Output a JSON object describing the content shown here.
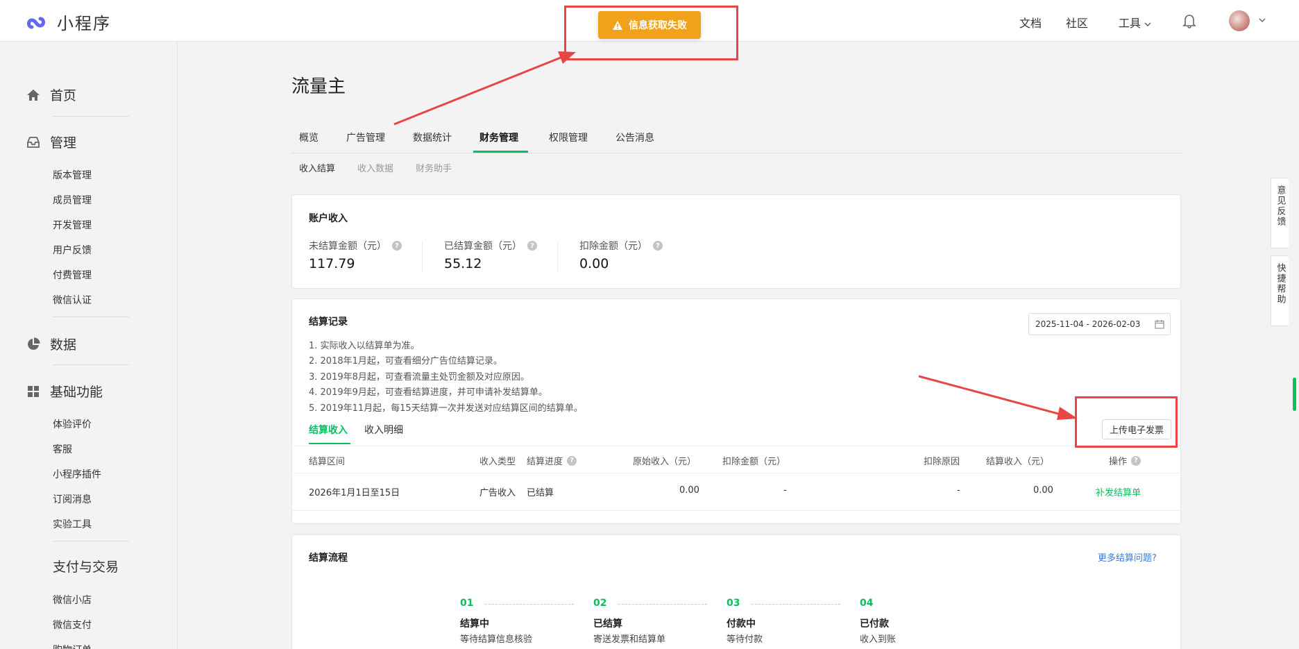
{
  "app": {
    "name": "小程序"
  },
  "topbar": {
    "nav": [
      "文档",
      "社区",
      "工具"
    ],
    "toast": "信息获取失败"
  },
  "sidebar": {
    "groups": [
      {
        "label": "首页",
        "icon": "home-icon"
      },
      {
        "label": "管理",
        "icon": "inbox-icon",
        "items": [
          "版本管理",
          "成员管理",
          "开发管理",
          "用户反馈",
          "付费管理",
          "微信认证"
        ]
      },
      {
        "label": "数据",
        "icon": "pie-chart-icon"
      },
      {
        "label": "基础功能",
        "icon": "grid-icon",
        "items": [
          "体验评价",
          "客服",
          "小程序插件",
          "订阅消息",
          "实验工具"
        ]
      },
      {
        "label": "支付与交易",
        "items": [
          "微信小店",
          "微信支付",
          "购物订单"
        ]
      }
    ]
  },
  "page": {
    "title": "流量主",
    "tabs": [
      "概览",
      "广告管理",
      "数据统计",
      "财务管理",
      "权限管理",
      "公告消息"
    ],
    "active_tab": "财务管理",
    "subtabs": [
      "收入结算",
      "收入数据",
      "财务助手"
    ]
  },
  "account": {
    "title": "账户收入",
    "metrics": [
      {
        "label": "未结算金额（元）",
        "value": "117.79"
      },
      {
        "label": "已结算金额（元）",
        "value": "55.12"
      },
      {
        "label": "扣除金额（元）",
        "value": "0.00"
      }
    ]
  },
  "records": {
    "title": "结算记录",
    "date_range": "2025-11-04 - 2026-02-03",
    "notes": [
      "1. 实际收入以结算单为准。",
      "2. 2018年1月起，可查看细分广告位结算记录。",
      "3. 2019年8月起，可查看流量主处罚金额及对应原因。",
      "4. 2019年9月起，可查看结算进度，并可申请补发结算单。",
      "5. 2019年11月起，每15天结算一次并发送对应结算区间的结算单。"
    ],
    "tabs": [
      "结算收入",
      "收入明细"
    ],
    "upload_button": "上传电子发票",
    "columns": [
      "结算区间",
      "收入类型",
      "结算进度",
      "原始收入（元）",
      "扣除金额（元）",
      "扣除原因",
      "结算收入（元）",
      "操作"
    ],
    "rows": [
      {
        "period": "2026年1月1日至15日",
        "type": "广告收入",
        "progress": "已结算",
        "original": "0.00",
        "deduction": "-",
        "reason": "-",
        "income": "0.00",
        "action": "补发结算单"
      }
    ]
  },
  "flow": {
    "title": "结算流程",
    "more_link": "更多结算问题?",
    "steps": [
      {
        "num": "01",
        "title": "结算中",
        "desc": "等待结算信息核验"
      },
      {
        "num": "02",
        "title": "已结算",
        "desc": "寄送发票和结算单"
      },
      {
        "num": "03",
        "title": "付款中",
        "desc": "等待付款"
      },
      {
        "num": "04",
        "title": "已付款",
        "desc": "收入到账"
      }
    ]
  },
  "float": {
    "feedback": "意见反馈",
    "help": "快捷帮助"
  },
  "colors": {
    "accent": "#07c160",
    "warning": "#f0a21b",
    "annotation": "#e84545"
  }
}
